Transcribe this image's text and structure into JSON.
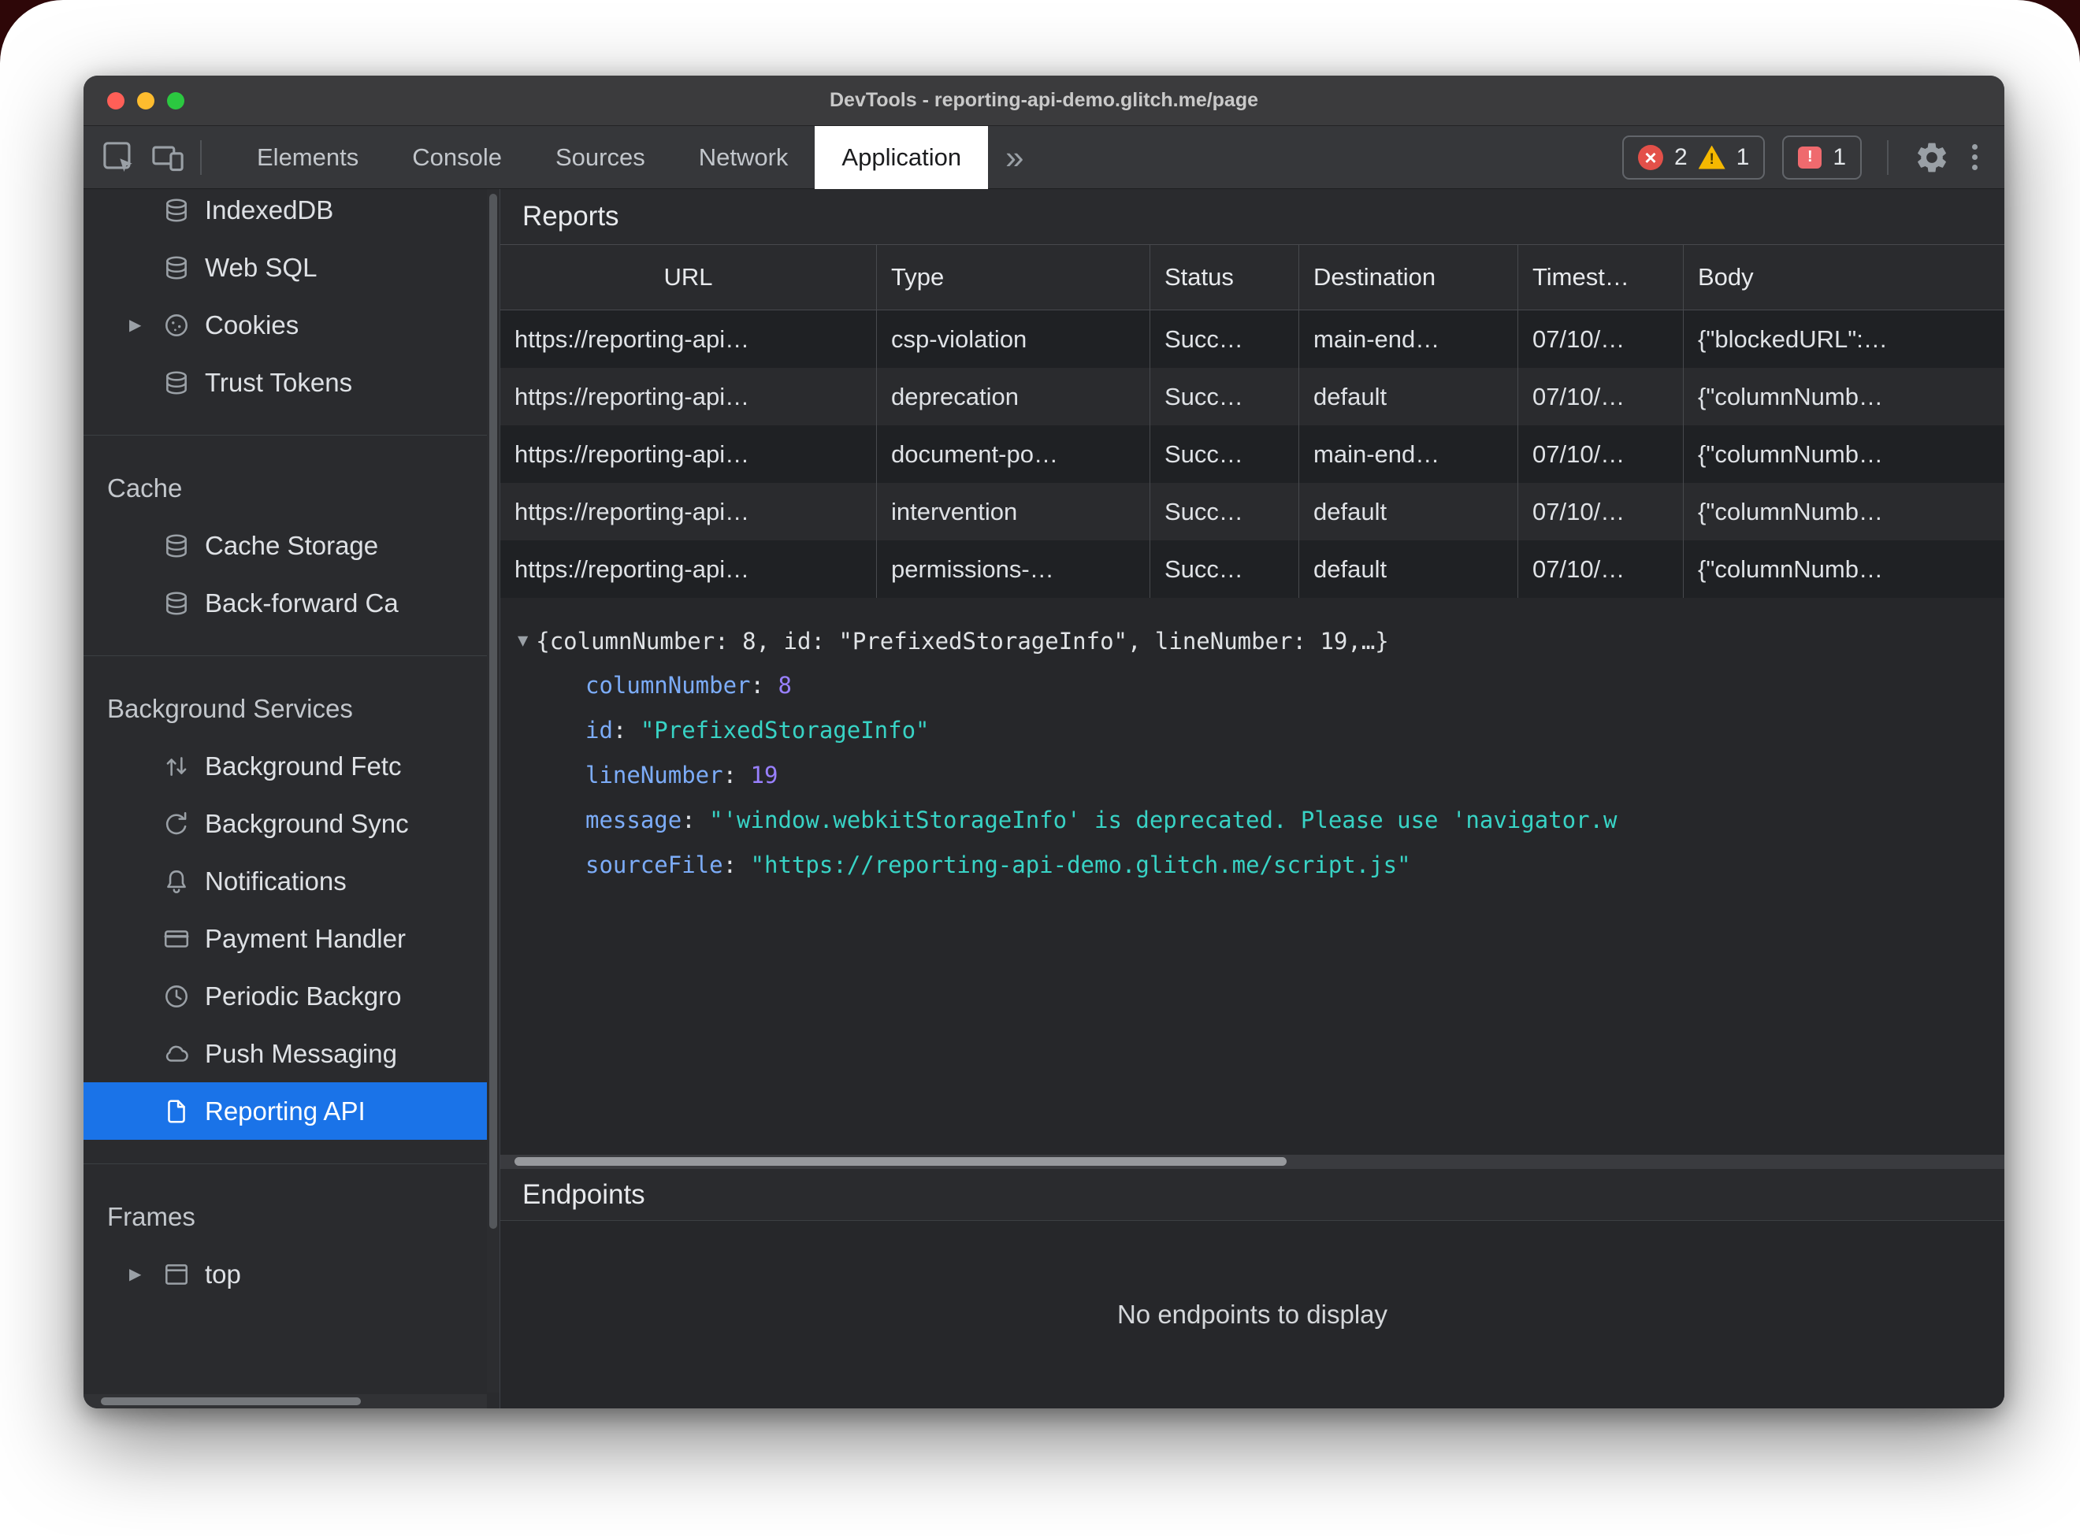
{
  "window": {
    "title": "DevTools - reporting-api-demo.glitch.me/page"
  },
  "toolbar": {
    "tabs": [
      {
        "label": "Elements",
        "active": false
      },
      {
        "label": "Console",
        "active": false
      },
      {
        "label": "Sources",
        "active": false
      },
      {
        "label": "Network",
        "active": false
      },
      {
        "label": "Application",
        "active": true
      }
    ],
    "badges": {
      "errors": "2",
      "warnings": "1",
      "issues": "1"
    }
  },
  "sidebar": {
    "items_top": [
      {
        "label": "IndexedDB",
        "icon": "database-icon"
      },
      {
        "label": "Web SQL",
        "icon": "database-icon"
      },
      {
        "label": "Cookies",
        "icon": "cookie-icon",
        "expandable": true
      },
      {
        "label": "Trust Tokens",
        "icon": "database-icon"
      }
    ],
    "cache_section": {
      "title": "Cache",
      "items": [
        {
          "label": "Cache Storage",
          "icon": "database-icon"
        },
        {
          "label": "Back-forward Ca",
          "icon": "database-icon"
        }
      ]
    },
    "background_section": {
      "title": "Background Services",
      "items": [
        {
          "label": "Background Fetc",
          "icon": "up-down-arrows-icon"
        },
        {
          "label": "Background Sync",
          "icon": "sync-icon"
        },
        {
          "label": "Notifications",
          "icon": "bell-icon"
        },
        {
          "label": "Payment Handler",
          "icon": "card-icon"
        },
        {
          "label": "Periodic Backgro",
          "icon": "clock-icon"
        },
        {
          "label": "Push Messaging",
          "icon": "cloud-icon"
        },
        {
          "label": "Reporting API",
          "icon": "file-icon",
          "selected": true
        }
      ]
    },
    "frames_section": {
      "title": "Frames",
      "items": [
        {
          "label": "top",
          "icon": "frame-icon",
          "expandable": true
        }
      ]
    }
  },
  "reports": {
    "title": "Reports",
    "columns": [
      "URL",
      "Type",
      "Status",
      "Destination",
      "Timest…",
      "Body"
    ],
    "rows": [
      [
        "https://reporting-api…",
        "csp-violation",
        "Succ…",
        "main-end…",
        "07/10/…",
        "{\"blockedURL\":…"
      ],
      [
        "https://reporting-api…",
        "deprecation",
        "Succ…",
        "default",
        "07/10/…",
        "{\"columnNumb…"
      ],
      [
        "https://reporting-api…",
        "document-po…",
        "Succ…",
        "main-end…",
        "07/10/…",
        "{\"columnNumb…"
      ],
      [
        "https://reporting-api…",
        "intervention",
        "Succ…",
        "default",
        "07/10/…",
        "{\"columnNumb…"
      ],
      [
        "https://reporting-api…",
        "permissions-…",
        "Succ…",
        "default",
        "07/10/…",
        "{\"columnNumb…"
      ]
    ]
  },
  "detail": {
    "summary": "{columnNumber: 8, id: \"PrefixedStorageInfo\", lineNumber: 19,…}",
    "props": [
      {
        "key": "columnNumber",
        "value": "8",
        "type": "number"
      },
      {
        "key": "id",
        "value": "\"PrefixedStorageInfo\"",
        "type": "string"
      },
      {
        "key": "lineNumber",
        "value": "19",
        "type": "number"
      },
      {
        "key": "message",
        "value": "\"'window.webkitStorageInfo' is deprecated. Please use 'navigator.w",
        "type": "string"
      },
      {
        "key": "sourceFile",
        "value": "\"https://reporting-api-demo.glitch.me/script.js\"",
        "type": "string"
      }
    ]
  },
  "endpoints": {
    "title": "Endpoints",
    "empty_message": "No endpoints to display"
  },
  "colors": {
    "accent": "#1a73e8",
    "error": "#e35049",
    "warning": "#f5b800",
    "issue": "#ef6a6e",
    "key": "#7cacf8",
    "str": "#38d3c5",
    "num": "#9980ff"
  }
}
